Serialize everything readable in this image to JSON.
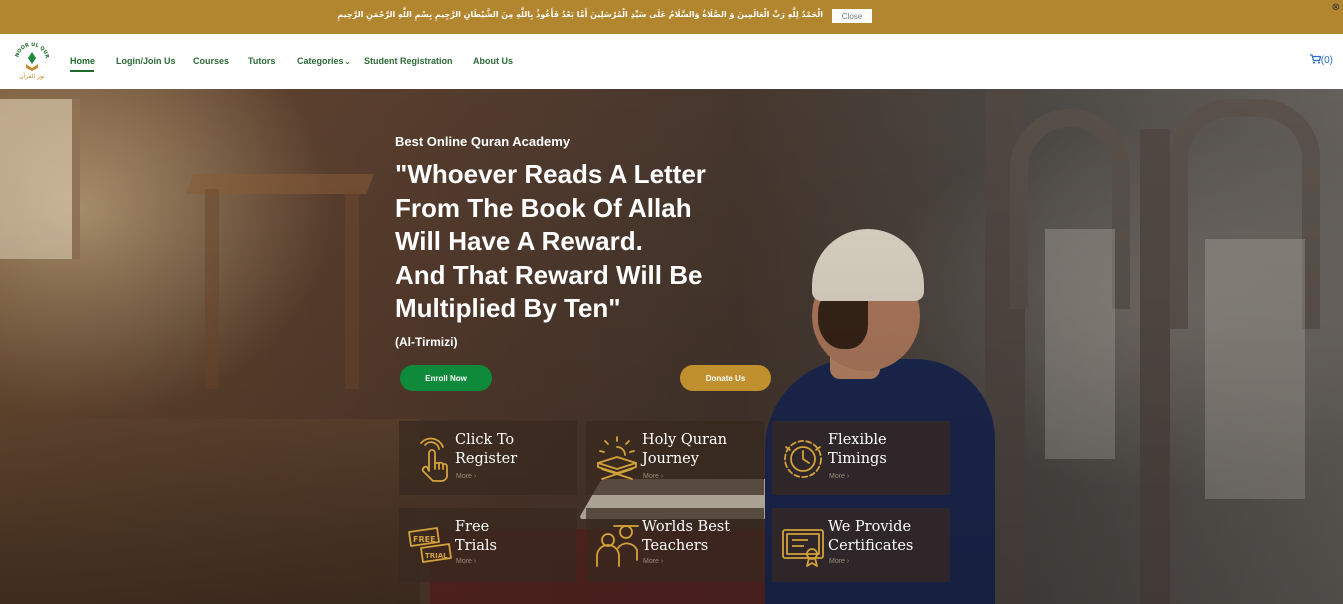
{
  "notice": {
    "text": "الْحَمْدُ لِلَّهِ رَبِّ الْعَالَمِينَ وَ الصَّلَاةُ وَالسَّلَامُ عَلَى سَيِّدِ الْمُرْسَلِينَ أَمَّا بَعْدُ فَأَعُوذُ بِاللَّهِ مِنَ الشَّيْطَانِ الرَّجِيمِ بِسْمِ اللَّهِ الرَّحْمَنِ الرَّحِيمِ",
    "close_label": "Close",
    "dismiss_glyph": "⊗",
    "background": "#b2852f"
  },
  "nav": {
    "logo_text": "NOOR UL QURAN",
    "logo_arabic": "نور القرآن",
    "items": [
      {
        "label": "Home",
        "active": true
      },
      {
        "label": "Login/Join Us"
      },
      {
        "label": "Courses"
      },
      {
        "label": "Tutors"
      },
      {
        "label": "Categories",
        "caret": "⌄"
      },
      {
        "label": "Student Registration"
      },
      {
        "label": "About Us"
      }
    ],
    "cart_icon": "cart-icon",
    "cart_count": "(0)",
    "link_color": "#2c6a36"
  },
  "hero": {
    "eyebrow": "Best Online Quran Academy",
    "headline_lines": [
      "\"Whoever Reads A Letter",
      "From The Book Of Allah",
      "Will Have A Reward.",
      "And That Reward Will Be",
      "Multiplied By Ten\""
    ],
    "source": "(Al-Tirmizi)",
    "enroll_label": "Enroll Now",
    "donate_label": "Donate Us",
    "enroll_color": "#0f8a3a",
    "donate_color": "#c0902f"
  },
  "features": [
    {
      "title_lines": [
        "Click To",
        "Register"
      ],
      "more": "More ›",
      "icon": "click-hand-icon"
    },
    {
      "title_lines": [
        "Holy Quran",
        "Journey"
      ],
      "more": "More ›",
      "icon": "quran-stand-icon"
    },
    {
      "title_lines": [
        "Flexible",
        "Timings"
      ],
      "more": "More ›",
      "icon": "clock-gear-icon"
    },
    {
      "title_lines": [
        "Free",
        "Trials"
      ],
      "more": "More ›",
      "icon": "free-trial-icon"
    },
    {
      "title_lines": [
        "Worlds Best",
        "Teachers"
      ],
      "more": "More ›",
      "icon": "teachers-icon"
    },
    {
      "title_lines": [
        "We Provide",
        "Certificates"
      ],
      "more": "More ›",
      "icon": "certificate-icon"
    }
  ],
  "accent_icon_color": "#d4a23a"
}
